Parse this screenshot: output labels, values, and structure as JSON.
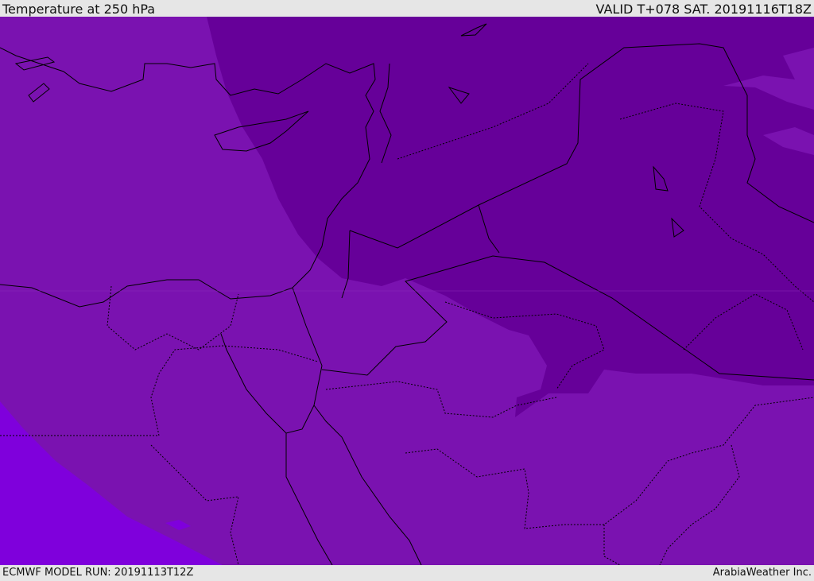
{
  "header": {
    "title": "Temperature at 250 hPa",
    "valid": "VALID T+078 SAT. 20191116T18Z"
  },
  "footer": {
    "model_run": "ECMWF MODEL RUN: 20191113T12Z",
    "credit": "ArabiaWeather Inc."
  },
  "colors": {
    "base": "#7a12b0",
    "cold": "#660099",
    "warm": "#7f00dc",
    "border": "#000000"
  }
}
